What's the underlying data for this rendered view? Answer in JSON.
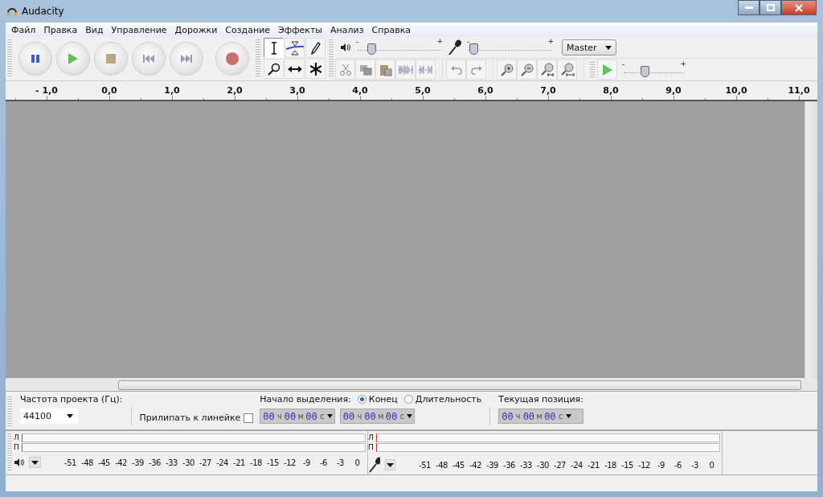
{
  "window": {
    "title": "Audacity"
  },
  "menu": [
    {
      "label": "Файл"
    },
    {
      "label": "Правка"
    },
    {
      "label": "Вид"
    },
    {
      "label": "Управление"
    },
    {
      "label": "Дорожки"
    },
    {
      "label": "Создание"
    },
    {
      "label": "Эффекты"
    },
    {
      "label": "Анализ"
    },
    {
      "label": "Справка"
    }
  ],
  "tools": [
    {
      "kind": "select",
      "selected": true
    },
    {
      "kind": "envelope",
      "selected": false
    },
    {
      "kind": "draw",
      "selected": false
    },
    {
      "kind": "zoom",
      "selected": false
    },
    {
      "kind": "timeshift",
      "selected": false
    },
    {
      "kind": "multi",
      "selected": false
    }
  ],
  "playback_gain": {
    "min_label": "-",
    "max_label": "+",
    "level": 0.15
  },
  "recording_gain": {
    "min_label": "-",
    "max_label": "+",
    "level": 0.05
  },
  "mixer_source": "Master",
  "play_speed": {
    "min_label": "-",
    "max_label": "+",
    "level": 0.33
  },
  "ruler": [
    "- 1,0",
    "0,0",
    "1,0",
    "2,0",
    "3,0",
    "4,0",
    "5,0",
    "6,0",
    "7,0",
    "8,0",
    "9,0",
    "10,0",
    "11,0"
  ],
  "selection_bar": {
    "rate_label": "Частота проекта (Гц):",
    "rate_value": "44100",
    "snap_label": "Прилипать к линейке",
    "snap_checked": false,
    "start_label": "Начало выделения:",
    "end_options": [
      {
        "label": "Конец",
        "selected": true
      },
      {
        "label": "Длительность",
        "selected": false
      }
    ],
    "position_label": "Текущая позиция:",
    "start_time": "00 ч 00 м 00 с",
    "end_time": "00 ч 00 м 00 с",
    "position_time": "00 ч 00 м 00 с"
  },
  "meters": [
    {
      "kind": "playback",
      "channels": [
        "Л",
        "П"
      ],
      "scale": [
        "-51",
        "-48",
        "-45",
        "-42",
        "-39",
        "-36",
        "-33",
        "-30",
        "-27",
        "-24",
        "-21",
        "-18",
        "-15",
        "-12",
        "-9",
        "-6",
        "-3",
        "0"
      ]
    },
    {
      "kind": "recording",
      "channels": [
        "Л",
        "П"
      ],
      "scale": [
        "-51",
        "-48",
        "-45",
        "-42",
        "-39",
        "-36",
        "-33",
        "-30",
        "-27",
        "-24",
        "-21",
        "-18",
        "-15",
        "-12",
        "-9",
        "-6",
        "-3",
        "0"
      ]
    }
  ]
}
